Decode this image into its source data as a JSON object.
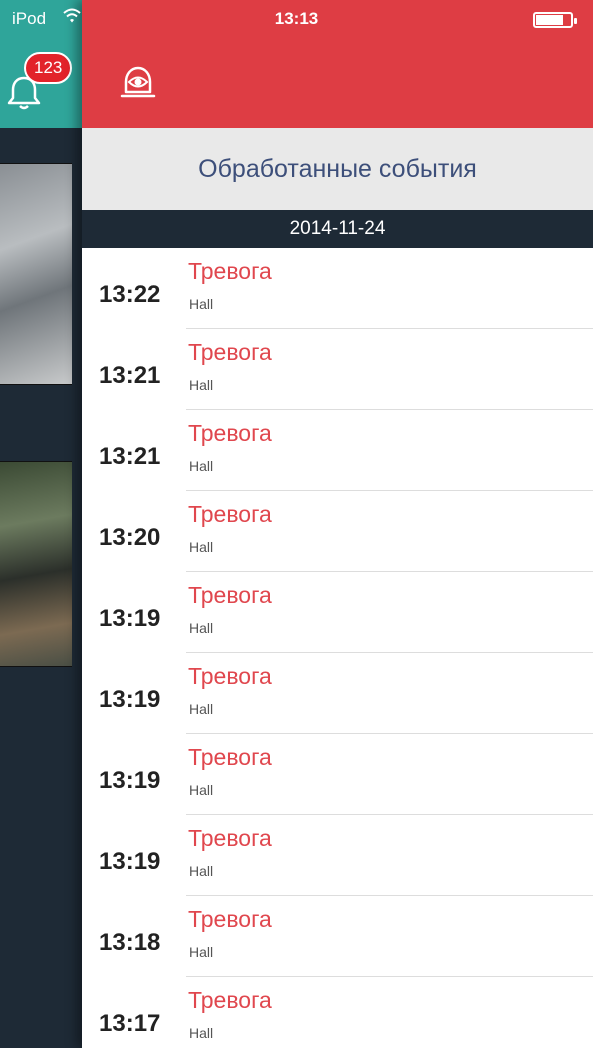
{
  "status_bar": {
    "carrier": "iPod",
    "time": "13:13"
  },
  "notifications": {
    "badge_count": "123"
  },
  "header": {
    "title": "Обработанные события"
  },
  "date_group": {
    "date": "2014-11-24"
  },
  "events": [
    {
      "time": "13:22",
      "type": "Тревога",
      "location": "Hall"
    },
    {
      "time": "13:21",
      "type": "Тревога",
      "location": "Hall"
    },
    {
      "time": "13:21",
      "type": "Тревога",
      "location": "Hall"
    },
    {
      "time": "13:20",
      "type": "Тревога",
      "location": "Hall"
    },
    {
      "time": "13:19",
      "type": "Тревога",
      "location": "Hall"
    },
    {
      "time": "13:19",
      "type": "Тревога",
      "location": "Hall"
    },
    {
      "time": "13:19",
      "type": "Тревога",
      "location": "Hall"
    },
    {
      "time": "13:19",
      "type": "Тревога",
      "location": "Hall"
    },
    {
      "time": "13:18",
      "type": "Тревога",
      "location": "Hall"
    },
    {
      "time": "13:17",
      "type": "Тревога",
      "location": "Hall"
    }
  ],
  "colors": {
    "header_red": "#de3d44",
    "teal": "#2fa59a",
    "dark_navy": "#1e2a36",
    "alarm_red": "#e0474e",
    "title_blue": "#3d4f7a"
  },
  "icons": {
    "bell": "bell-icon",
    "eye_alarm": "eye-alarm-icon",
    "wifi": "wifi-icon",
    "battery": "battery-icon"
  }
}
